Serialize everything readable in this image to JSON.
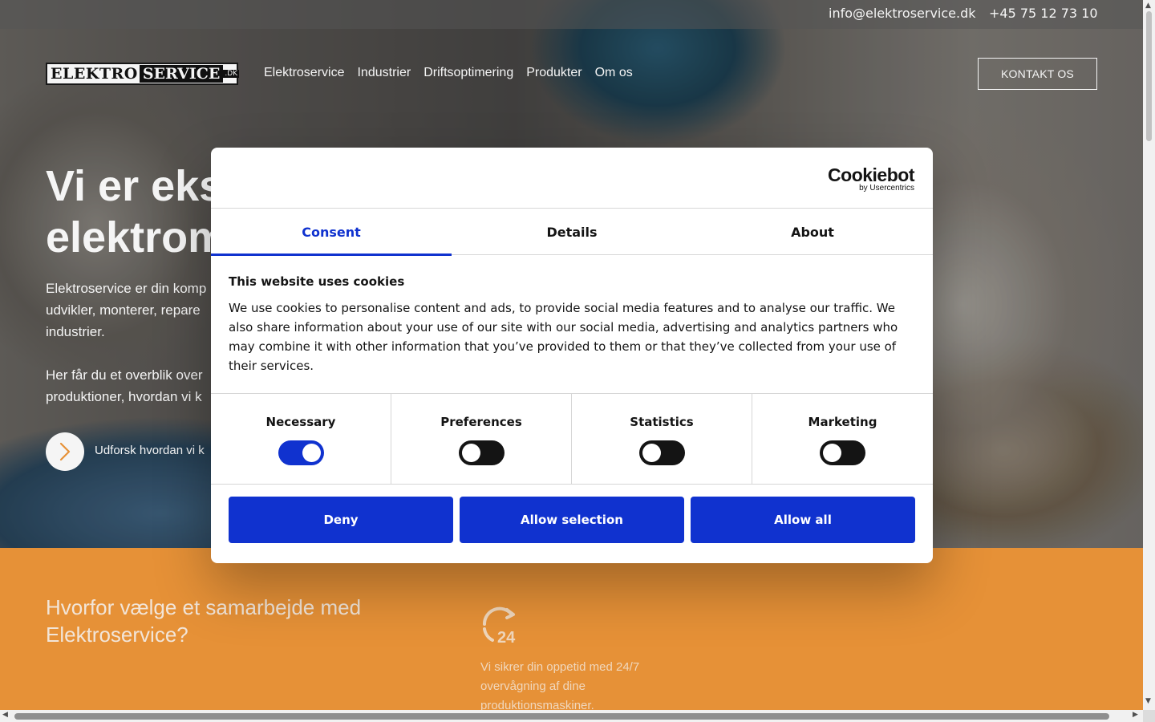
{
  "topbar": {
    "email": "info@elektroservice.dk",
    "phone": "+45 75 12 73 10"
  },
  "logo": {
    "part1": "ELEKTRO",
    "part2": "SERVICE",
    "suffix": ".DK"
  },
  "nav": {
    "items": [
      "Elektroservice",
      "Industrier",
      "Driftsoptimering",
      "Produkter",
      "Om os"
    ]
  },
  "header": {
    "contact_label": "KONTAKT OS"
  },
  "hero": {
    "title_line1": "Vi er eks",
    "title_line2": "elektrom",
    "text1_line1": "Elektroservice er din komp",
    "text1_line2": "udvikler, monterer, repare",
    "text1_line3": "industrier.",
    "text2_line1": "Her får du et overblik over",
    "text2_line2": "produktioner, hvordan vi k",
    "explore_label": "Udforsk hvordan vi k"
  },
  "why": {
    "title": "Hvorfor vælge et samarbejde med Elektroservice?",
    "icon": "24-hour-icon",
    "uptime_text": "Vi sikrer din oppetid med 24/7 overvågning af dine produktionsmaskiner."
  },
  "cookie": {
    "brand": "Cookiebot",
    "brand_sub": "by Usercentrics",
    "tabs": [
      "Consent",
      "Details",
      "About"
    ],
    "active_tab": "Consent",
    "heading": "This website uses cookies",
    "text": "We use cookies to personalise content and ads, to provide social media features and to analyse our traffic. We also share information about your use of our site with our social media, advertising and analytics partners who may combine it with other information that you’ve provided to them or that they’ve collected from your use of their services.",
    "toggles": [
      {
        "label": "Necessary",
        "on": true
      },
      {
        "label": "Preferences",
        "on": false
      },
      {
        "label": "Statistics",
        "on": false
      },
      {
        "label": "Marketing",
        "on": false
      }
    ],
    "buttons": {
      "deny": "Deny",
      "allow_selection": "Allow selection",
      "allow_all": "Allow all"
    }
  },
  "colors": {
    "accent_blue": "#1032cf",
    "orange": "#f0973a"
  }
}
